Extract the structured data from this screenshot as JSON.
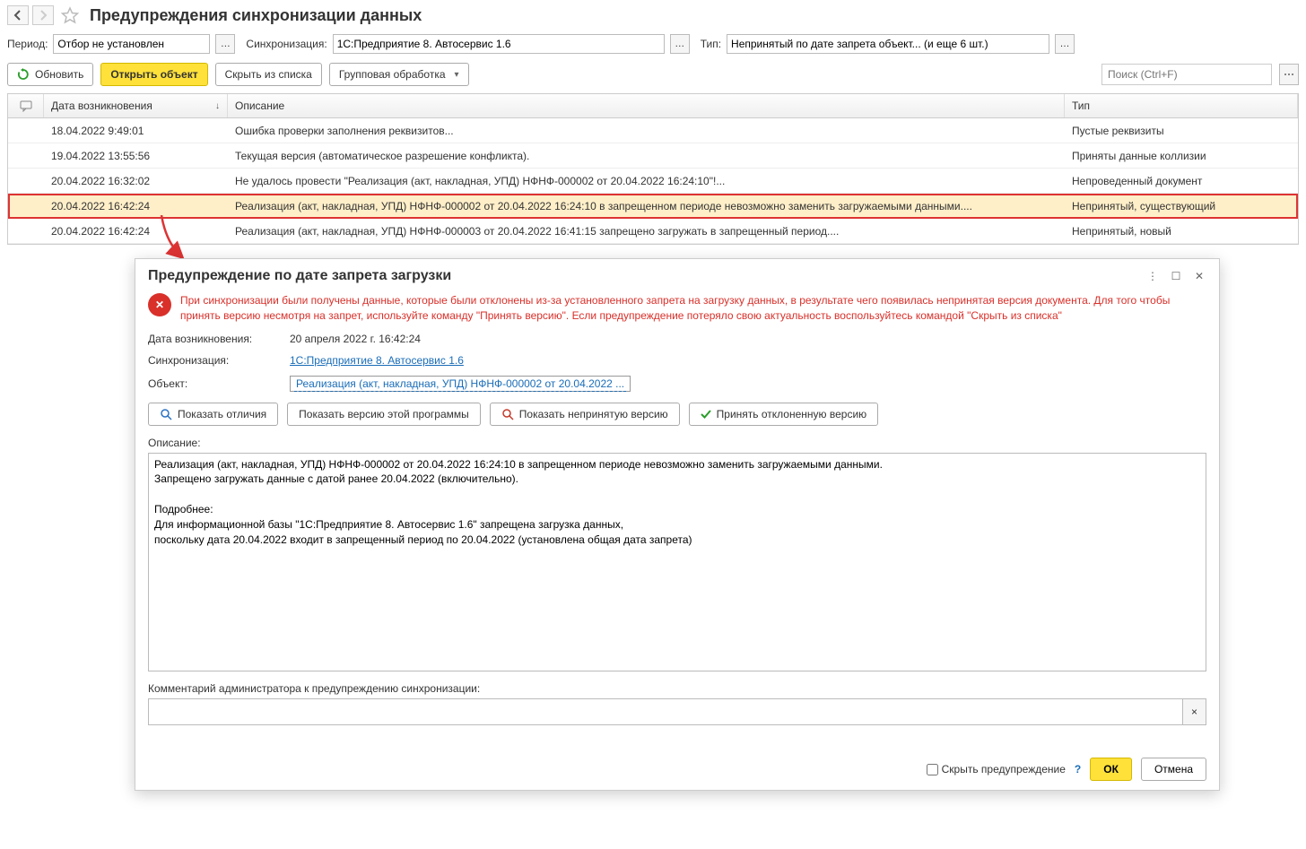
{
  "header": {
    "title": "Предупреждения синхронизации данных"
  },
  "filters": {
    "period_label": "Период:",
    "period_value": "Отбор не установлен",
    "sync_label": "Синхронизация:",
    "sync_value": "1С:Предприятие 8. Автосервис 1.6",
    "type_label": "Тип:",
    "type_value": "Непринятый по дате запрета объект... (и еще 6 шт.)"
  },
  "toolbar": {
    "refresh": "Обновить",
    "open_object": "Открыть объект",
    "hide_from_list": "Скрыть из списка",
    "group_processing": "Групповая обработка",
    "search_placeholder": "Поиск (Ctrl+F)"
  },
  "table": {
    "col_date": "Дата возникновения",
    "col_desc": "Описание",
    "col_type": "Тип",
    "rows": [
      {
        "date": "18.04.2022 9:49:01",
        "desc": "Ошибка проверки заполнения реквизитов...",
        "type": "Пустые реквизиты"
      },
      {
        "date": "19.04.2022 13:55:56",
        "desc": "Текущая версия (автоматическое разрешение конфликта).",
        "type": "Приняты данные коллизии"
      },
      {
        "date": "20.04.2022 16:32:02",
        "desc": "Не удалось провести \"Реализация (акт, накладная, УПД) НФНФ-000002 от 20.04.2022 16:24:10\"!...",
        "type": "Непроведенный документ"
      },
      {
        "date": "20.04.2022 16:42:24",
        "desc": "Реализация (акт, накладная, УПД) НФНФ-000002 от 20.04.2022 16:24:10 в запрещенном периоде невозможно заменить загружаемыми данными....",
        "type": "Непринятый, существующий"
      },
      {
        "date": "20.04.2022 16:42:24",
        "desc": "Реализация (акт, накладная, УПД) НФНФ-000003 от 20.04.2022 16:41:15 запрещено загружать в запрещенный период....",
        "type": "Непринятый, новый"
      }
    ],
    "highlight_index": 3
  },
  "dialog": {
    "title": "Предупреждение по дате запрета загрузки",
    "warning": "При синхронизации были получены данные, которые были отклонены из-за установленного запрета на загрузку данных, в результате чего появилась непринятая версия документа. Для того чтобы принять версию несмотря на запрет, используйте команду \"Принять версию\". Если предупреждение потеряло свою актуальность воспользуйтесь командой \"Скрыть из списка\"",
    "date_label": "Дата возникновения:",
    "date_value": "20 апреля 2022 г. 16:42:24",
    "sync_label": "Синхронизация:",
    "sync_link": "1С:Предприятие 8. Автосервис 1.6",
    "object_label": "Объект:",
    "object_link": "Реализация (акт, накладная, УПД) НФНФ-000002 от 20.04.2022 ...",
    "buttons": {
      "show_diff": "Показать отличия",
      "show_this_version": "Показать версию этой программы",
      "show_rejected": "Показать непринятую версию",
      "accept_rejected": "Принять отклоненную версию"
    },
    "desc_label": "Описание:",
    "desc_text": "Реализация (акт, накладная, УПД) НФНФ-000002 от 20.04.2022 16:24:10 в запрещенном периоде невозможно заменить загружаемыми данными.\nЗапрещено загружать данные с датой ранее 20.04.2022 (включительно).\n\nПодробнее:\nДля информационной базы \"1С:Предприятие 8. Автосервис 1.6\" запрещена загрузка данных,\nпоскольку дата 20.04.2022 входит в запрещенный период по 20.04.2022 (установлена общая дата запрета)",
    "admin_label": "Комментарий администратора к предупреждению синхронизации:",
    "hide_checkbox": "Скрыть предупреждение",
    "ok": "ОК",
    "cancel": "Отмена"
  }
}
